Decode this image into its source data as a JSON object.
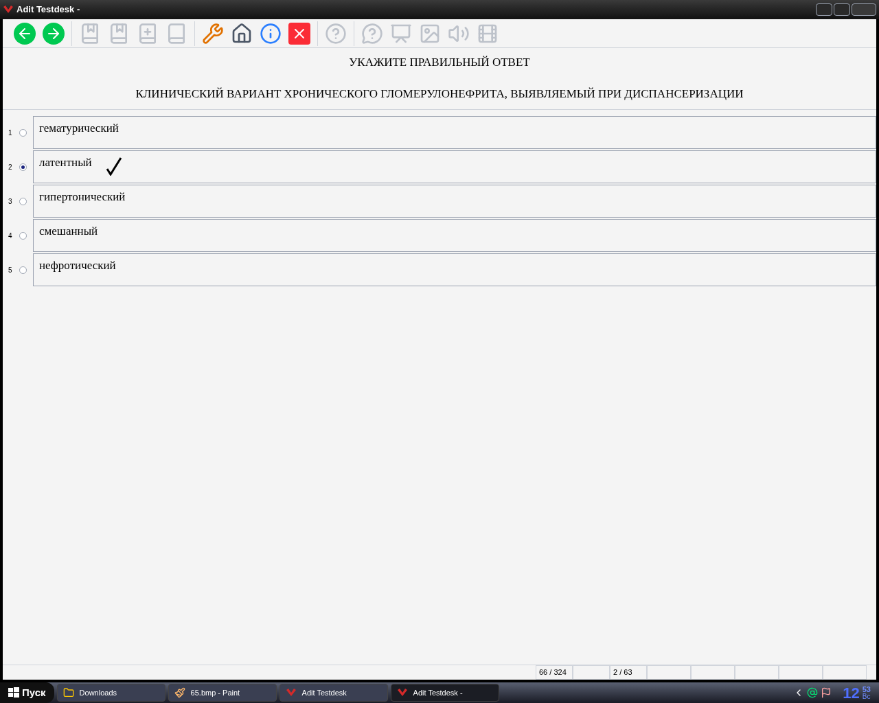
{
  "window": {
    "title": "Adit Testdesk -"
  },
  "toolbar": [
    {
      "kind": "back",
      "disabled": false
    },
    {
      "kind": "forward",
      "disabled": false
    },
    {
      "kind": "sep"
    },
    {
      "kind": "book-prev",
      "disabled": true
    },
    {
      "kind": "book-next",
      "disabled": true
    },
    {
      "kind": "book-add",
      "disabled": true
    },
    {
      "kind": "book",
      "disabled": true
    },
    {
      "kind": "sep"
    },
    {
      "kind": "tools",
      "disabled": false
    },
    {
      "kind": "home",
      "disabled": false
    },
    {
      "kind": "info",
      "disabled": false
    },
    {
      "kind": "close",
      "disabled": false
    },
    {
      "kind": "sep"
    },
    {
      "kind": "help",
      "disabled": true
    },
    {
      "kind": "sep"
    },
    {
      "kind": "hint",
      "disabled": true
    },
    {
      "kind": "slides",
      "disabled": true
    },
    {
      "kind": "image",
      "disabled": true
    },
    {
      "kind": "sound",
      "disabled": true
    },
    {
      "kind": "video",
      "disabled": true
    }
  ],
  "question": {
    "instruction": "УКАЖИТЕ ПРАВИЛЬНЫЙ ОТВЕТ",
    "text": "КЛИНИЧЕСКИЙ ВАРИАНТ ХРОНИЧЕСКОГО ГЛОМЕРУЛОНЕФРИТА, ВЫЯВЛЯЕМЫЙ ПРИ ДИСПАНСЕРИЗАЦИИ"
  },
  "answers": [
    {
      "number": "1",
      "text": "гематурический",
      "selected": false,
      "marked": false
    },
    {
      "number": "2",
      "text": "латентный",
      "selected": true,
      "marked": true
    },
    {
      "number": "3",
      "text": "гипертонический",
      "selected": false,
      "marked": false
    },
    {
      "number": "4",
      "text": "смешанный",
      "selected": false,
      "marked": false
    },
    {
      "number": "5",
      "text": "нефротический",
      "selected": false,
      "marked": false
    }
  ],
  "status_bar": [
    "66 / 324",
    "2 / 63"
  ],
  "taskbar": {
    "start": "Пуск",
    "tasks": [
      {
        "kind": "folder",
        "label": "Downloads",
        "selected": false
      },
      {
        "kind": "paint",
        "label": "65.bmp - Paint",
        "selected": false
      },
      {
        "kind": "app",
        "label": "Adit Testdesk",
        "selected": false
      },
      {
        "kind": "app",
        "label": "Adit Testdesk -",
        "selected": true
      }
    ],
    "clock": {
      "hour": "12",
      "minute": "53",
      "day": "Вс"
    }
  }
}
